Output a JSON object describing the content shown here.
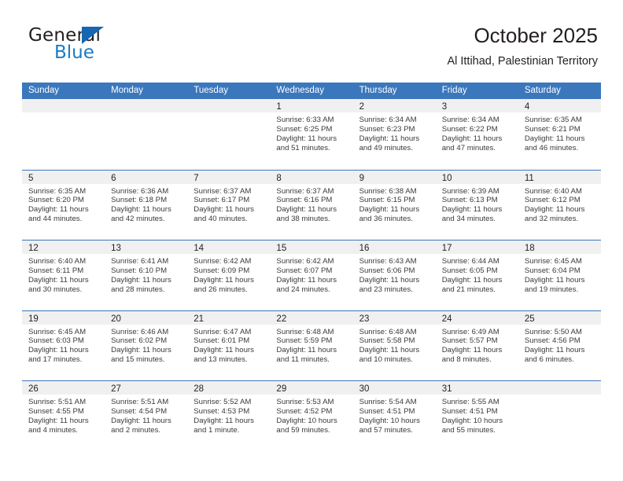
{
  "brand": {
    "name_top": "General",
    "name_bottom": "Blue",
    "triangle_color": "#1567b2",
    "blue_text_color": "#1a7bc4"
  },
  "header": {
    "title": "October 2025",
    "subtitle": "Al Ittihad, Palestinian Territory"
  },
  "theme": {
    "header_blue": "#3b77bd",
    "day_band_gray": "#f0f0f0",
    "text_color": "#231f20"
  },
  "calendar": {
    "weekday_headers": [
      "Sunday",
      "Monday",
      "Tuesday",
      "Wednesday",
      "Thursday",
      "Friday",
      "Saturday"
    ],
    "labels": {
      "sunrise": "Sunrise:",
      "sunset": "Sunset:",
      "daylight": "Daylight:"
    },
    "weeks": [
      [
        {
          "day": "",
          "sunrise": "",
          "sunset": "",
          "daylight_line1": "",
          "daylight_line2": ""
        },
        {
          "day": "",
          "sunrise": "",
          "sunset": "",
          "daylight_line1": "",
          "daylight_line2": ""
        },
        {
          "day": "",
          "sunrise": "",
          "sunset": "",
          "daylight_line1": "",
          "daylight_line2": ""
        },
        {
          "day": "1",
          "sunrise": "Sunrise: 6:33 AM",
          "sunset": "Sunset: 6:25 PM",
          "daylight_line1": "Daylight: 11 hours",
          "daylight_line2": "and 51 minutes."
        },
        {
          "day": "2",
          "sunrise": "Sunrise: 6:34 AM",
          "sunset": "Sunset: 6:23 PM",
          "daylight_line1": "Daylight: 11 hours",
          "daylight_line2": "and 49 minutes."
        },
        {
          "day": "3",
          "sunrise": "Sunrise: 6:34 AM",
          "sunset": "Sunset: 6:22 PM",
          "daylight_line1": "Daylight: 11 hours",
          "daylight_line2": "and 47 minutes."
        },
        {
          "day": "4",
          "sunrise": "Sunrise: 6:35 AM",
          "sunset": "Sunset: 6:21 PM",
          "daylight_line1": "Daylight: 11 hours",
          "daylight_line2": "and 46 minutes."
        }
      ],
      [
        {
          "day": "5",
          "sunrise": "Sunrise: 6:35 AM",
          "sunset": "Sunset: 6:20 PM",
          "daylight_line1": "Daylight: 11 hours",
          "daylight_line2": "and 44 minutes."
        },
        {
          "day": "6",
          "sunrise": "Sunrise: 6:36 AM",
          "sunset": "Sunset: 6:18 PM",
          "daylight_line1": "Daylight: 11 hours",
          "daylight_line2": "and 42 minutes."
        },
        {
          "day": "7",
          "sunrise": "Sunrise: 6:37 AM",
          "sunset": "Sunset: 6:17 PM",
          "daylight_line1": "Daylight: 11 hours",
          "daylight_line2": "and 40 minutes."
        },
        {
          "day": "8",
          "sunrise": "Sunrise: 6:37 AM",
          "sunset": "Sunset: 6:16 PM",
          "daylight_line1": "Daylight: 11 hours",
          "daylight_line2": "and 38 minutes."
        },
        {
          "day": "9",
          "sunrise": "Sunrise: 6:38 AM",
          "sunset": "Sunset: 6:15 PM",
          "daylight_line1": "Daylight: 11 hours",
          "daylight_line2": "and 36 minutes."
        },
        {
          "day": "10",
          "sunrise": "Sunrise: 6:39 AM",
          "sunset": "Sunset: 6:13 PM",
          "daylight_line1": "Daylight: 11 hours",
          "daylight_line2": "and 34 minutes."
        },
        {
          "day": "11",
          "sunrise": "Sunrise: 6:40 AM",
          "sunset": "Sunset: 6:12 PM",
          "daylight_line1": "Daylight: 11 hours",
          "daylight_line2": "and 32 minutes."
        }
      ],
      [
        {
          "day": "12",
          "sunrise": "Sunrise: 6:40 AM",
          "sunset": "Sunset: 6:11 PM",
          "daylight_line1": "Daylight: 11 hours",
          "daylight_line2": "and 30 minutes."
        },
        {
          "day": "13",
          "sunrise": "Sunrise: 6:41 AM",
          "sunset": "Sunset: 6:10 PM",
          "daylight_line1": "Daylight: 11 hours",
          "daylight_line2": "and 28 minutes."
        },
        {
          "day": "14",
          "sunrise": "Sunrise: 6:42 AM",
          "sunset": "Sunset: 6:09 PM",
          "daylight_line1": "Daylight: 11 hours",
          "daylight_line2": "and 26 minutes."
        },
        {
          "day": "15",
          "sunrise": "Sunrise: 6:42 AM",
          "sunset": "Sunset: 6:07 PM",
          "daylight_line1": "Daylight: 11 hours",
          "daylight_line2": "and 24 minutes."
        },
        {
          "day": "16",
          "sunrise": "Sunrise: 6:43 AM",
          "sunset": "Sunset: 6:06 PM",
          "daylight_line1": "Daylight: 11 hours",
          "daylight_line2": "and 23 minutes."
        },
        {
          "day": "17",
          "sunrise": "Sunrise: 6:44 AM",
          "sunset": "Sunset: 6:05 PM",
          "daylight_line1": "Daylight: 11 hours",
          "daylight_line2": "and 21 minutes."
        },
        {
          "day": "18",
          "sunrise": "Sunrise: 6:45 AM",
          "sunset": "Sunset: 6:04 PM",
          "daylight_line1": "Daylight: 11 hours",
          "daylight_line2": "and 19 minutes."
        }
      ],
      [
        {
          "day": "19",
          "sunrise": "Sunrise: 6:45 AM",
          "sunset": "Sunset: 6:03 PM",
          "daylight_line1": "Daylight: 11 hours",
          "daylight_line2": "and 17 minutes."
        },
        {
          "day": "20",
          "sunrise": "Sunrise: 6:46 AM",
          "sunset": "Sunset: 6:02 PM",
          "daylight_line1": "Daylight: 11 hours",
          "daylight_line2": "and 15 minutes."
        },
        {
          "day": "21",
          "sunrise": "Sunrise: 6:47 AM",
          "sunset": "Sunset: 6:01 PM",
          "daylight_line1": "Daylight: 11 hours",
          "daylight_line2": "and 13 minutes."
        },
        {
          "day": "22",
          "sunrise": "Sunrise: 6:48 AM",
          "sunset": "Sunset: 5:59 PM",
          "daylight_line1": "Daylight: 11 hours",
          "daylight_line2": "and 11 minutes."
        },
        {
          "day": "23",
          "sunrise": "Sunrise: 6:48 AM",
          "sunset": "Sunset: 5:58 PM",
          "daylight_line1": "Daylight: 11 hours",
          "daylight_line2": "and 10 minutes."
        },
        {
          "day": "24",
          "sunrise": "Sunrise: 6:49 AM",
          "sunset": "Sunset: 5:57 PM",
          "daylight_line1": "Daylight: 11 hours",
          "daylight_line2": "and 8 minutes."
        },
        {
          "day": "25",
          "sunrise": "Sunrise: 5:50 AM",
          "sunset": "Sunset: 4:56 PM",
          "daylight_line1": "Daylight: 11 hours",
          "daylight_line2": "and 6 minutes."
        }
      ],
      [
        {
          "day": "26",
          "sunrise": "Sunrise: 5:51 AM",
          "sunset": "Sunset: 4:55 PM",
          "daylight_line1": "Daylight: 11 hours",
          "daylight_line2": "and 4 minutes."
        },
        {
          "day": "27",
          "sunrise": "Sunrise: 5:51 AM",
          "sunset": "Sunset: 4:54 PM",
          "daylight_line1": "Daylight: 11 hours",
          "daylight_line2": "and 2 minutes."
        },
        {
          "day": "28",
          "sunrise": "Sunrise: 5:52 AM",
          "sunset": "Sunset: 4:53 PM",
          "daylight_line1": "Daylight: 11 hours",
          "daylight_line2": "and 1 minute."
        },
        {
          "day": "29",
          "sunrise": "Sunrise: 5:53 AM",
          "sunset": "Sunset: 4:52 PM",
          "daylight_line1": "Daylight: 10 hours",
          "daylight_line2": "and 59 minutes."
        },
        {
          "day": "30",
          "sunrise": "Sunrise: 5:54 AM",
          "sunset": "Sunset: 4:51 PM",
          "daylight_line1": "Daylight: 10 hours",
          "daylight_line2": "and 57 minutes."
        },
        {
          "day": "31",
          "sunrise": "Sunrise: 5:55 AM",
          "sunset": "Sunset: 4:51 PM",
          "daylight_line1": "Daylight: 10 hours",
          "daylight_line2": "and 55 minutes."
        },
        {
          "day": "",
          "sunrise": "",
          "sunset": "",
          "daylight_line1": "",
          "daylight_line2": ""
        }
      ]
    ]
  }
}
